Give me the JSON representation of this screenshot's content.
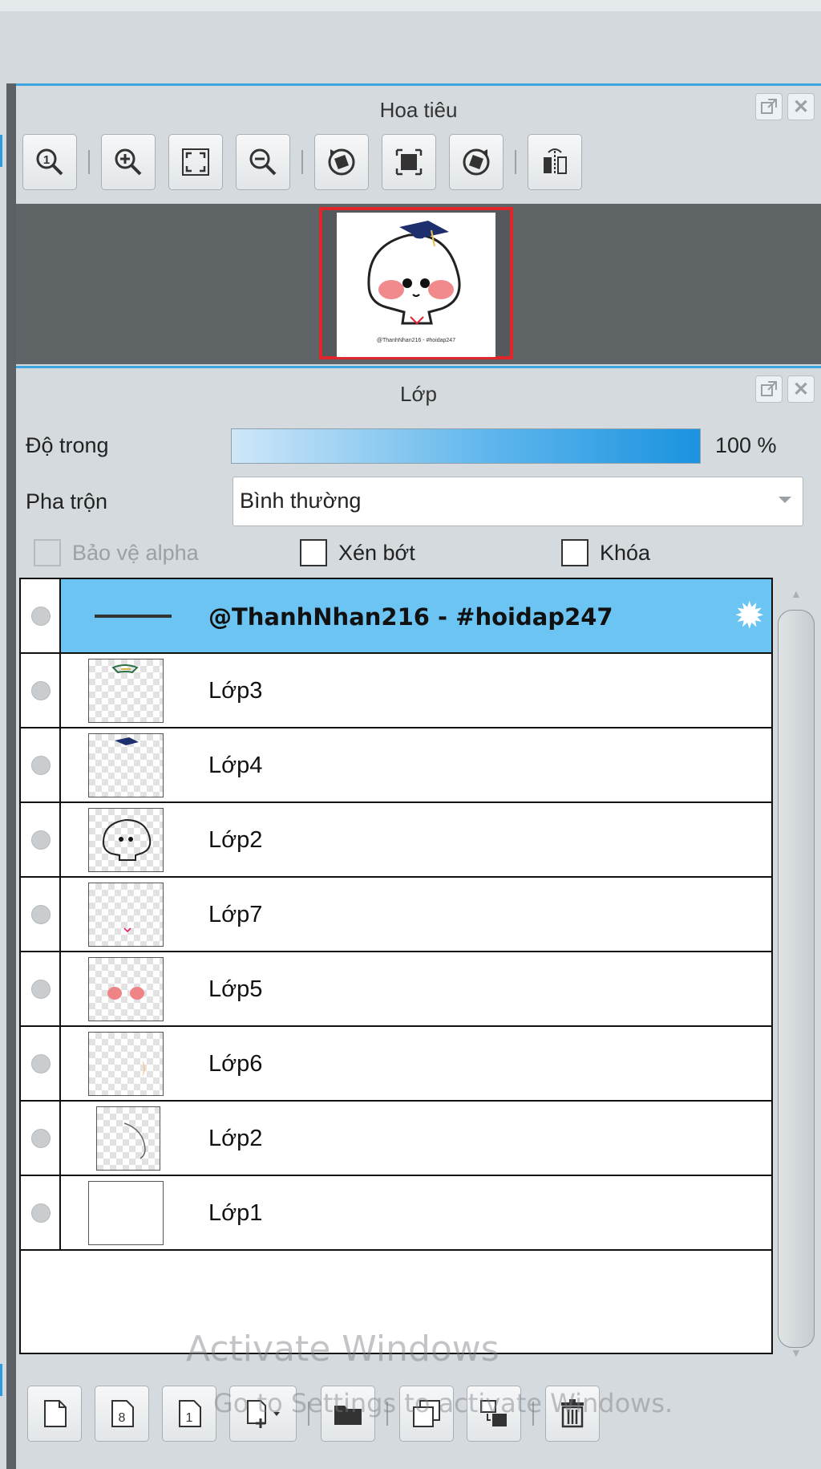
{
  "navigator": {
    "title": "Hoa tiêu",
    "toolbar": [
      {
        "icon": "zoom-actual-icon"
      },
      {
        "icon": "zoom-in-icon"
      },
      {
        "icon": "fit-window-icon"
      },
      {
        "icon": "zoom-out-icon"
      },
      {
        "icon": "rotate-left-icon"
      },
      {
        "icon": "reset-rotation-icon"
      },
      {
        "icon": "rotate-right-icon"
      },
      {
        "icon": "flip-horizontal-icon"
      }
    ],
    "preview_caption": "@ThanhNhan216 - #hoidap247"
  },
  "layers_panel": {
    "title": "Lớp",
    "opacity_label": "Độ trong",
    "opacity_value": "100 %",
    "opacity_fraction": 1.0,
    "blend_label": "Pha trộn",
    "blend_value": "Bình thường",
    "protect_alpha_label": "Bảo vệ alpha",
    "clip_label": "Xén bớt",
    "lock_label": "Khóa",
    "layers": [
      {
        "name": "@ThanhNhan216 - #hoidap247",
        "selected": true
      },
      {
        "name": "Lớp3",
        "selected": false
      },
      {
        "name": "Lớp4",
        "selected": false
      },
      {
        "name": "Lớp2",
        "selected": false
      },
      {
        "name": "Lớp7",
        "selected": false
      },
      {
        "name": "Lớp5",
        "selected": false
      },
      {
        "name": "Lớp6",
        "selected": false
      },
      {
        "name": "Lớp2",
        "selected": false
      },
      {
        "name": "Lớp1",
        "selected": false
      }
    ]
  },
  "bottom_toolbar": [
    {
      "icon": "new-layer-icon"
    },
    {
      "icon": "new-8bit-layer-icon"
    },
    {
      "icon": "new-1bit-layer-icon"
    },
    {
      "icon": "add-layer-menu-icon"
    },
    {
      "icon": "new-folder-icon"
    },
    {
      "icon": "duplicate-layer-icon"
    },
    {
      "icon": "merge-down-icon"
    },
    {
      "icon": "delete-layer-icon"
    }
  ],
  "watermark": {
    "title": "Activate Windows",
    "subtitle": "Go to Settings to activate Windows."
  },
  "colors": {
    "accent": "#3da6df",
    "selected_row": "#6cc4f2",
    "navigator_frame": "#e0262a"
  }
}
